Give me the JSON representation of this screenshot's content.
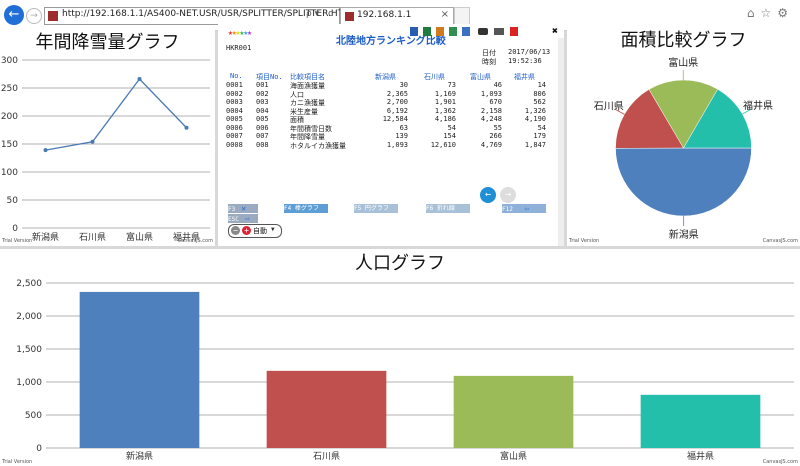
{
  "browser": {
    "url": "http://192.168.1.1/AS400-NET.USR/USR/SPLITTER/SPLITTER.HTM",
    "tab_title": "192.168.1.1",
    "addr_controls": "ρ▾ c"
  },
  "panel_snow": {
    "title": "年間降雪量グラフ",
    "footer_left": "Trial Version",
    "footer_right": "CanvasJS.com"
  },
  "panel_area": {
    "title": "面積比較グラフ",
    "footer_left": "Trial Version",
    "footer_right": "CanvasJS.com"
  },
  "panel_pop": {
    "title": "人口グラフ",
    "footer_left": "Trial Version",
    "footer_right": "CanvasJS.com"
  },
  "terminal": {
    "logo": "北陸地方ランキング比較",
    "screen_id": "HKR001",
    "date_label": "日付",
    "date_value": "2017/06/13",
    "time_label": "時刻",
    "time_value": "19:52:36",
    "close_glyph": "✖",
    "headers": [
      "No.",
      "項目No.",
      "比較項目名",
      "新潟県",
      "石川県",
      "富山県",
      "福井県"
    ],
    "rows": [
      [
        "0001",
        "001",
        "海面漁獲量",
        "30",
        "73",
        "46",
        "14"
      ],
      [
        "0002",
        "002",
        "人口",
        "2,365",
        "1,169",
        "1,093",
        "806"
      ],
      [
        "0003",
        "003",
        "カニ漁獲量",
        "2,700",
        "1,901",
        "670",
        "562"
      ],
      [
        "0004",
        "004",
        "米生産量",
        "6,192",
        "1,362",
        "2,158",
        "1,326"
      ],
      [
        "0005",
        "005",
        "面積",
        "12,584",
        "4,186",
        "4,248",
        "4,190"
      ],
      [
        "0006",
        "006",
        "年間積雪日数",
        "63",
        "54",
        "55",
        "54"
      ],
      [
        "0007",
        "007",
        "年間降雪量",
        "139",
        "154",
        "266",
        "179"
      ],
      [
        "0008",
        "008",
        "ホタルイカ漁獲量",
        "1,093",
        "12,610",
        "4,769",
        "1,847"
      ]
    ],
    "fkeys": [
      {
        "key": "F3",
        "label": "✕"
      },
      {
        "key": "F4",
        "label": "棒グラフ"
      },
      {
        "key": "F5",
        "label": "円グラフ"
      },
      {
        "key": "F6",
        "label": "折れ線"
      },
      {
        "key": "F12",
        "label": "⇦"
      },
      {
        "key": "ESC",
        "label": "⇨"
      }
    ],
    "mode_select": "自動"
  },
  "chart_data": [
    {
      "type": "line",
      "title": "年間降雪量グラフ",
      "categories": [
        "新潟県",
        "石川県",
        "富山県",
        "福井県"
      ],
      "values": [
        139,
        154,
        266,
        179
      ],
      "ylim": [
        0,
        300
      ],
      "yticks": [
        0,
        50,
        100,
        150,
        200,
        250,
        300
      ],
      "color": "#4a7ab5",
      "grid": true
    },
    {
      "type": "pie",
      "title": "面積比較グラフ",
      "labels": [
        "新潟県",
        "石川県",
        "富山県",
        "福井県"
      ],
      "values": [
        12584,
        4186,
        4248,
        4190
      ],
      "colors": [
        "#4e80bd",
        "#c0504e",
        "#9bbb59",
        "#23bfaa"
      ]
    },
    {
      "type": "bar",
      "title": "人口グラフ",
      "categories": [
        "新潟県",
        "石川県",
        "富山県",
        "福井県"
      ],
      "values": [
        2365,
        1169,
        1093,
        806
      ],
      "ylim": [
        0,
        2500
      ],
      "yticks": [
        "0",
        "500",
        "1,000",
        "1,500",
        "2,000",
        "2,500"
      ],
      "colors": [
        "#4e80bd",
        "#c0504e",
        "#9bbb59",
        "#23bfaa"
      ],
      "grid": true
    }
  ]
}
